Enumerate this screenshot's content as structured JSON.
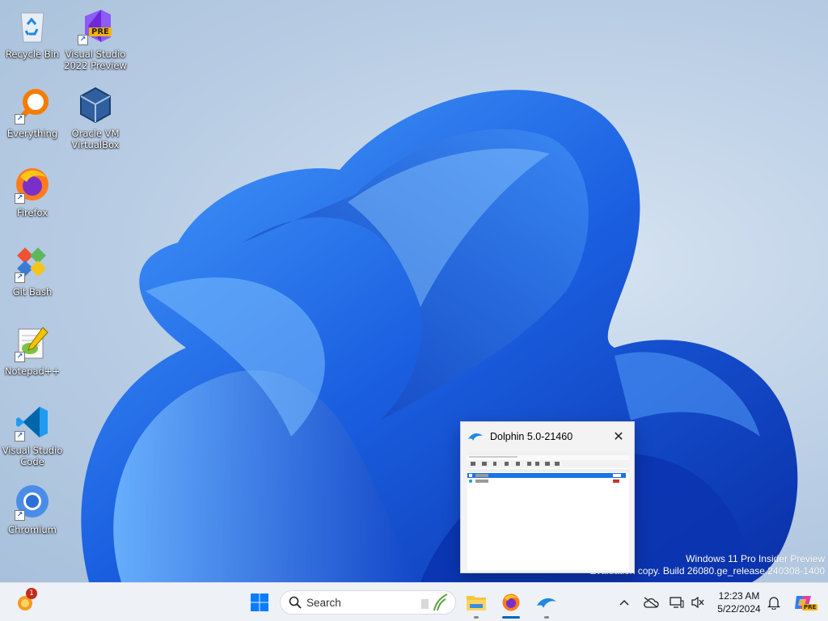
{
  "desktop": {
    "icons": [
      {
        "label_lines": [
          "Recycle Bin"
        ],
        "icon": "recycle-bin-icon"
      },
      {
        "label_lines": [
          "Visual Studio",
          "2022 Preview"
        ],
        "icon": "visual-studio-preview-icon",
        "badge": "PRE"
      },
      {
        "label_lines": [
          "Everything"
        ],
        "icon": "everything-search-icon"
      },
      {
        "label_lines": [
          "Oracle VM",
          "VirtualBox"
        ],
        "icon": "virtualbox-icon"
      },
      {
        "label_lines": [
          "Firefox"
        ],
        "icon": "firefox-icon"
      },
      {
        "label_lines": [
          "Git Bash"
        ],
        "icon": "git-bash-icon"
      },
      {
        "label_lines": [
          "Notepad++"
        ],
        "icon": "notepad-plus-plus-icon"
      },
      {
        "label_lines": [
          "Visual Studio",
          "Code"
        ],
        "icon": "vscode-icon"
      },
      {
        "label_lines": [
          "Chromium"
        ],
        "icon": "chromium-icon"
      }
    ],
    "watermark": {
      "line1": "Windows 11 Pro Insider Preview",
      "line2": "Evaluation copy. Build 26080.ge_release.240308-1400"
    }
  },
  "preview": {
    "title": "Dolphin 5.0-21460",
    "close_icon": "close-icon"
  },
  "taskbar": {
    "widgets_badge": "1",
    "search_placeholder": "Search",
    "clock": {
      "time": "12:23 AM",
      "date": "5/22/2024"
    },
    "copilot_badge": "PRE"
  },
  "colors": {
    "accent": "#0067c0",
    "taskbar_bg": "#eef2f7",
    "bloom_blue": "#1a5fe0"
  }
}
